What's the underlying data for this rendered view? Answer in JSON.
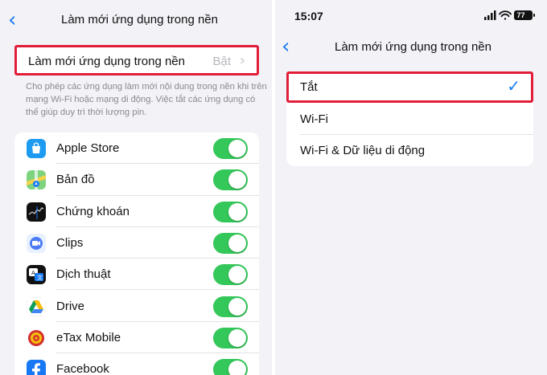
{
  "left": {
    "back_icon": "chevron-left-icon",
    "title": "Làm mới ứng dụng trong nền",
    "setting": {
      "label": "Làm mới ứng dụng trong nền",
      "value": "Bật"
    },
    "description": "Cho phép các ứng dụng làm mới nội dung trong nền khi trên mạng Wi-Fi hoặc mạng di động. Việc tắt các ứng dụng có thể giúp duy trì thời lượng pin.",
    "apps": [
      {
        "name": "Apple Store",
        "icon": "apple-store-icon",
        "on": true
      },
      {
        "name": "Bản đồ",
        "icon": "maps-icon",
        "on": true
      },
      {
        "name": "Chứng khoán",
        "icon": "stocks-icon",
        "on": true
      },
      {
        "name": "Clips",
        "icon": "clips-icon",
        "on": true
      },
      {
        "name": "Dịch thuật",
        "icon": "translate-icon",
        "on": true
      },
      {
        "name": "Drive",
        "icon": "drive-icon",
        "on": true
      },
      {
        "name": "eTax Mobile",
        "icon": "etax-mobile-icon",
        "on": true
      },
      {
        "name": "Facebook",
        "icon": "facebook-icon",
        "on": true
      }
    ]
  },
  "right": {
    "status_time": "15:07",
    "battery": "77",
    "back_icon": "chevron-left-icon",
    "title": "Làm mới ứng dụng trong nền",
    "options": [
      {
        "label": "Tắt",
        "selected": true
      },
      {
        "label": "Wi-Fi",
        "selected": false
      },
      {
        "label": "Wi-Fi & Dữ liệu di động",
        "selected": false
      }
    ]
  },
  "colors": {
    "accent": "#1a7cf2",
    "toggle_on": "#34c759",
    "highlight": "#e21d3a",
    "background": "#f2f2f7"
  }
}
